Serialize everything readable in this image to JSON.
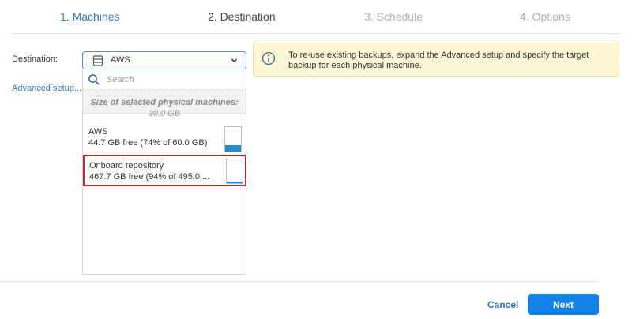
{
  "wizard": {
    "steps": [
      {
        "label": "1. Machines",
        "state": "completed"
      },
      {
        "label": "2. Destination",
        "state": "active"
      },
      {
        "label": "3. Schedule",
        "state": "pending"
      },
      {
        "label": "4. Options",
        "state": "pending"
      }
    ]
  },
  "destination": {
    "label": "Destination:",
    "selected": "AWS",
    "selected_icon": "database-icon",
    "advanced_link": "Advanced setup...",
    "dropdown": {
      "search_placeholder": "Search",
      "size_title": "Size of selected physical machines:",
      "size_value": "30.0 GB",
      "items": [
        {
          "name": "AWS",
          "free": "44.7 GB free (74% of 60.0 GB)",
          "free_fraction": 0.26
        },
        {
          "name": "Onboard repository",
          "free": "467.7 GB free (94% of 495.0 ...",
          "free_fraction": 0.06,
          "highlighted": true
        }
      ]
    }
  },
  "info": {
    "icon": "info-icon",
    "message": "To re-use existing backups, expand the Advanced setup and specify the target backup for each physical machine."
  },
  "footer": {
    "cancel_label": "Cancel",
    "next_label": "Next"
  },
  "colors": {
    "accent": "#1281e8",
    "link": "#2f78c4",
    "highlight_border": "#cc1f2d",
    "info_bg": "#fdf7d6",
    "gauge_fill": "#1e8fd3"
  }
}
